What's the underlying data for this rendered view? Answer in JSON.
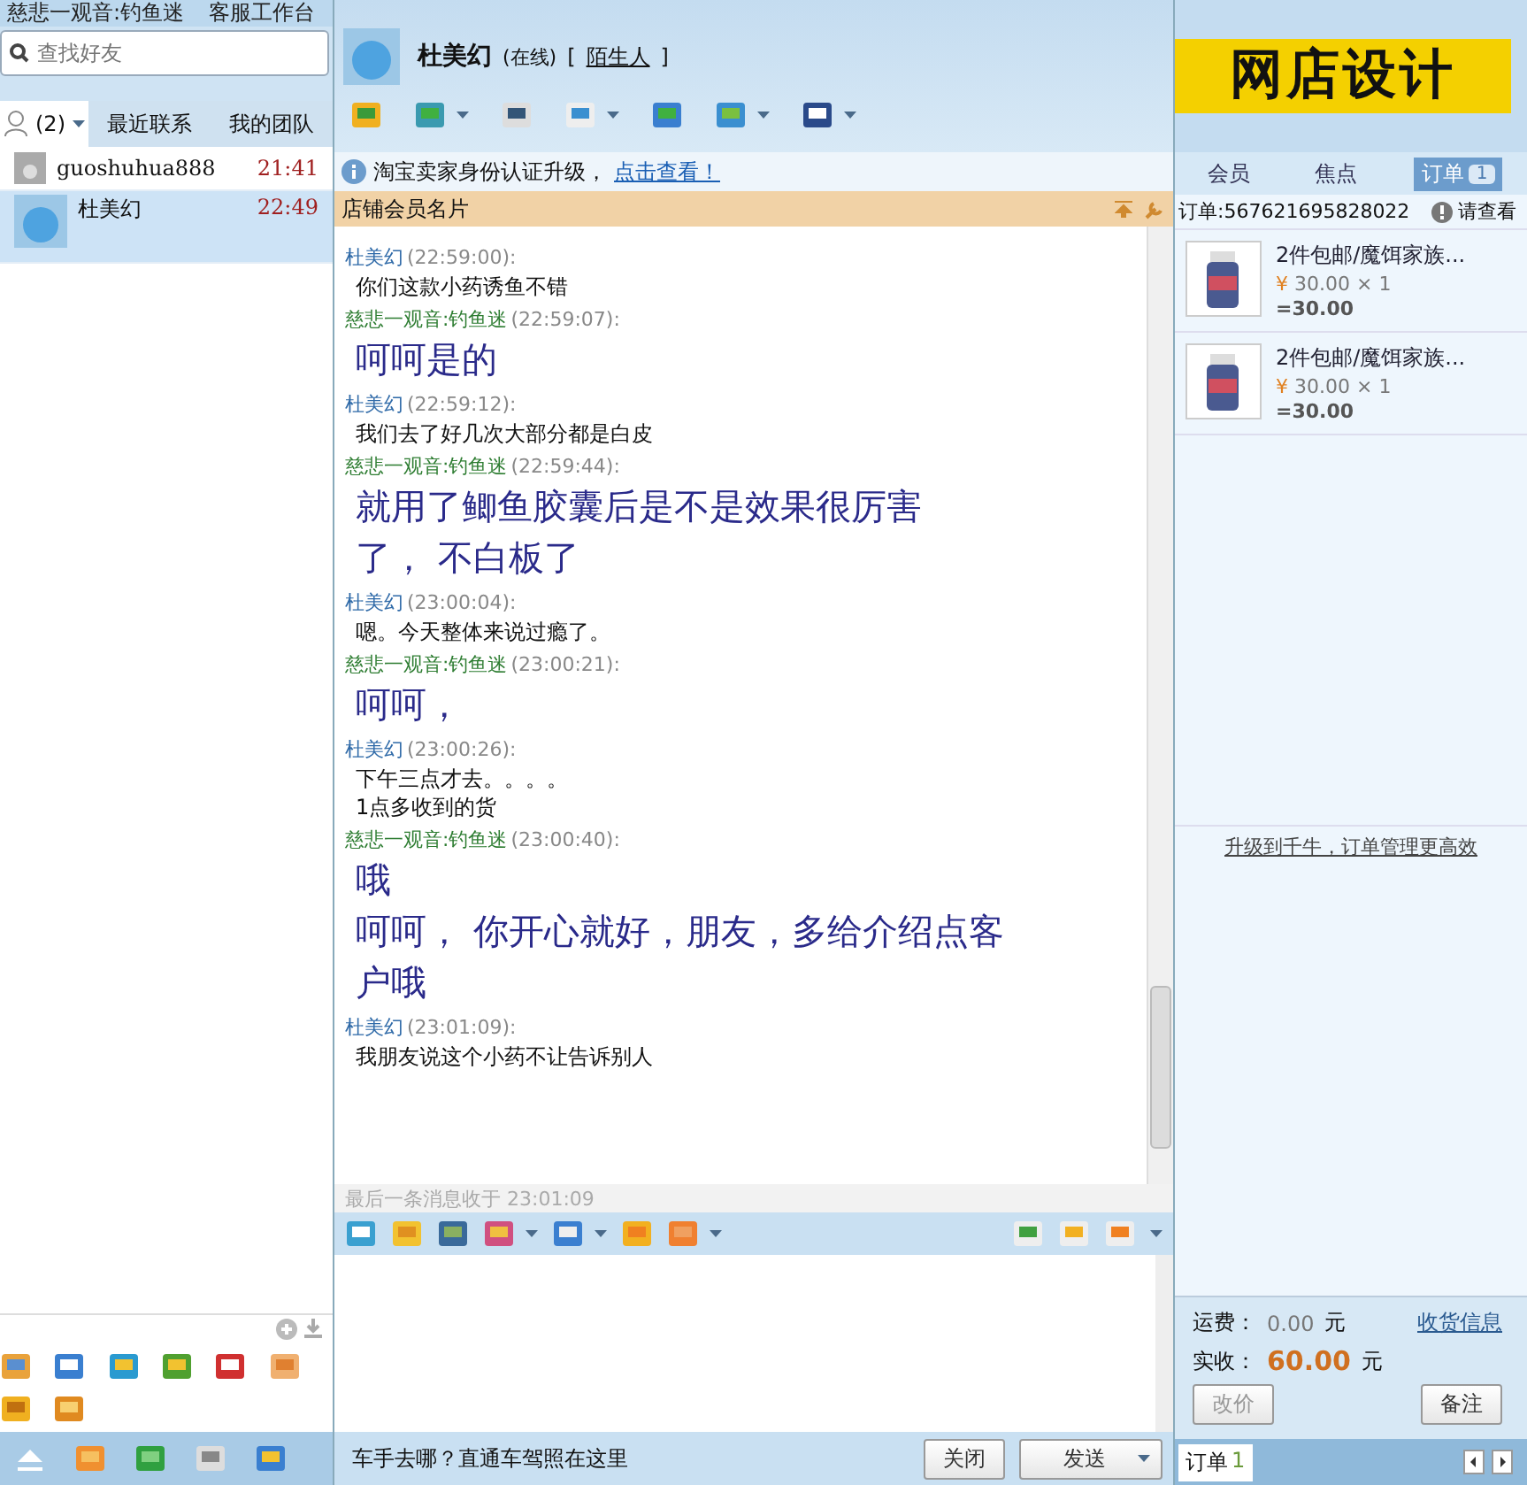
{
  "window": {
    "title": "慈悲一观音:钓鱼迷",
    "app_name": "客服工作台"
  },
  "contacts_panel": {
    "search": {
      "placeholder": "查找好友"
    },
    "tabs": [
      {
        "label": "(2)",
        "selected": true
      },
      {
        "label": "最近联系",
        "selected": false
      },
      {
        "label": "我的团队",
        "selected": false
      }
    ],
    "contacts": [
      {
        "name": "guoshuhua888",
        "time": "21:41",
        "selected": false,
        "online": false
      },
      {
        "name": "杜美幻",
        "time": "22:49",
        "selected": true,
        "online": true
      }
    ]
  },
  "chat": {
    "contact": {
      "name": "杜美幻",
      "status": "(在线)",
      "tag": "陌生人",
      "open_bracket": "[",
      "close_bracket": "]"
    },
    "notice": {
      "text": "淘宝卖家身份认证升级，",
      "link": "点击查看！"
    },
    "card_bar": {
      "title": "店铺会员名片"
    },
    "messages": [
      {
        "kind": "customer",
        "sender": "杜美幻",
        "time": "(22:59:00):",
        "lines": [
          "你们这款小药诱鱼不错"
        ]
      },
      {
        "kind": "seller",
        "sender": "慈悲一观音:钓鱼迷",
        "time": "(22:59:07):",
        "lines": [
          "呵呵是的"
        ]
      },
      {
        "kind": "customer",
        "sender": "杜美幻",
        "time": "(22:59:12):",
        "lines": [
          "我们去了好几次大部分都是白皮"
        ]
      },
      {
        "kind": "seller",
        "sender": "慈悲一观音:钓鱼迷",
        "time": "(22:59:44):",
        "lines": [
          "就用了鲫鱼胶囊后是不是效果很厉害",
          "了， 不白板了"
        ]
      },
      {
        "kind": "customer",
        "sender": "杜美幻",
        "time": "(23:00:04):",
        "lines": [
          "嗯。今天整体来说过瘾了。"
        ]
      },
      {
        "kind": "seller",
        "sender": "慈悲一观音:钓鱼迷",
        "time": "(23:00:21):",
        "lines": [
          "呵呵，"
        ]
      },
      {
        "kind": "customer",
        "sender": "杜美幻",
        "time": "(23:00:26):",
        "lines": [
          "下午三点才去。。。。",
          "1点多收到的货"
        ]
      },
      {
        "kind": "seller",
        "sender": "慈悲一观音:钓鱼迷",
        "time": "(23:00:40):",
        "lines": [
          "哦",
          "呵呵， 你开心就好，朋友，多给介绍点客",
          "户哦"
        ]
      },
      {
        "kind": "customer",
        "sender": "杜美幻",
        "time": "(23:01:09):",
        "lines": [
          "我朋友说这个小药不让告诉别人"
        ]
      }
    ],
    "last_message": "最后一条消息收于 23:01:09",
    "ad_text": "车手去哪？直通车驾照在这里",
    "buttons": {
      "close": "关闭",
      "send": "发送"
    }
  },
  "order_panel": {
    "banner": "网店设计",
    "tabs": [
      {
        "label": "会员",
        "selected": false
      },
      {
        "label": "焦点",
        "selected": false
      },
      {
        "label": "订单",
        "badge": "1",
        "selected": true
      }
    ],
    "order_no": "订单:567621695828022",
    "view": "请查看",
    "items": [
      {
        "title": "2件包邮/魔饵家族...",
        "price": "30.00 × 1",
        "currency": "¥",
        "total": "=30.00"
      },
      {
        "title": "2件包邮/魔饵家族...",
        "price": "30.00 × 1",
        "currency": "¥",
        "total": "=30.00"
      }
    ],
    "upgrade_link": "升级到千牛，订单管理更高效",
    "shipping_label": "运费：",
    "shipping_value": "0.00",
    "shipping_unit": "元",
    "address_link": "收货信息",
    "paid_label": "实收：",
    "paid_value": "60.00",
    "paid_unit": "元",
    "buttons": {
      "change_price": "改价",
      "note": "备注"
    },
    "bottom_tab": {
      "label": "订单",
      "badge": "1"
    }
  }
}
